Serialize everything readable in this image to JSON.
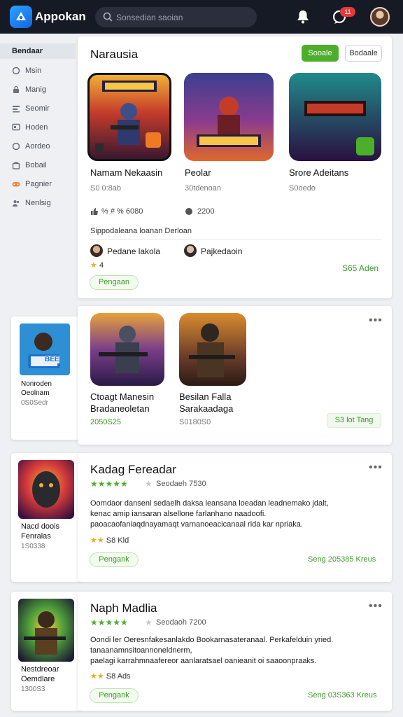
{
  "header": {
    "app_name": "Appokan",
    "search_placeholder": "Sonsedian saoian",
    "notifications_count": "11"
  },
  "sidebar": {
    "items": [
      {
        "label": "Bendaar",
        "icon": "none",
        "active": true
      },
      {
        "label": "Msin",
        "icon": "circle-icon"
      },
      {
        "label": "Manig",
        "icon": "lock-icon"
      },
      {
        "label": "Seomir",
        "icon": "tools-icon"
      },
      {
        "label": "Hoden",
        "icon": "monitor-icon"
      },
      {
        "label": "Aordeo",
        "icon": "clock-icon"
      },
      {
        "label": "Bobail",
        "icon": "bag-icon"
      },
      {
        "label": "Pagnier",
        "icon": "controller-icon",
        "accent": "#f08a3c"
      },
      {
        "label": "Nenlsig",
        "icon": "users-icon"
      }
    ]
  },
  "featured": {
    "title": "Narausia",
    "primary_button": "Sooale",
    "secondary_button": "Bodaale",
    "games": [
      {
        "name": "Namam Nekaasin",
        "meta": "S0 0:8ab"
      },
      {
        "name": "Peolar",
        "meta": "30tdenoan"
      },
      {
        "name": "Srore Adeitans",
        "meta": "S0oedo"
      }
    ],
    "stat_1": "% # % 6080",
    "stat_2": "2200",
    "subheading": "Sippodaleana loanan Derloan",
    "user_1": "Pedane lakola",
    "user_2": "Pajkedaoin",
    "user_1_rating": "4",
    "pill_label": "Pengaan",
    "link_label": "S65 Aden"
  },
  "section2": {
    "side_game": {
      "name": "Nonroden Oeolnam",
      "meta": "0S0Sedr",
      "badge": "BEE"
    },
    "games": [
      {
        "name": "Ctoagt Manesin Bradaneoletan",
        "meta": "2050S25"
      },
      {
        "name": "Besilan Falla Sarakaadaga",
        "meta": "S0180S0"
      }
    ],
    "tag_label": "S3 lot Tang",
    "more": "•••"
  },
  "list_items": [
    {
      "title": "Kadag Fereadar",
      "rating_text": "Seodaeh 7530",
      "desc_lines": [
        "Oomdaor dansenl sedaelh daksa leansana loeadan leadnemako jdalt,",
        "kenac amip iansaran alsellone farlanhano naadoofi.",
        "paoacaofaniaqdnayamaqt varnanoeacicanaal rida kar npriaka."
      ],
      "mini_rating": "S8 Kld",
      "button": "Pengank",
      "price": "Seng 205385 Kreus",
      "side_name": "Nacd doois Fenralas",
      "side_meta": "1S0338",
      "more": "•••"
    },
    {
      "title": "Naph Madlia",
      "rating_text": "Seodaoh 7200",
      "desc_lines": [
        "Oondi ler Oeresnfakesanlakdo Bookarnasateranaal. Perkafelduin yried.",
        "tanaanamnsitoannoneldnerm,",
        "paelagi karrahmnaafereor aanlaratsael oanieanit oi saaoonpraaks."
      ],
      "mini_rating": "S8 Ads",
      "button": "Pengank",
      "price": "Seng 03S363 Kreus",
      "side_name": "Nestdreoar Oemdlare",
      "side_meta": "1300S3",
      "more": "•••"
    }
  ],
  "colors": {
    "topbar": "#161a24",
    "accent_green": "#4caf2a",
    "badge_red": "#e63a3a"
  }
}
